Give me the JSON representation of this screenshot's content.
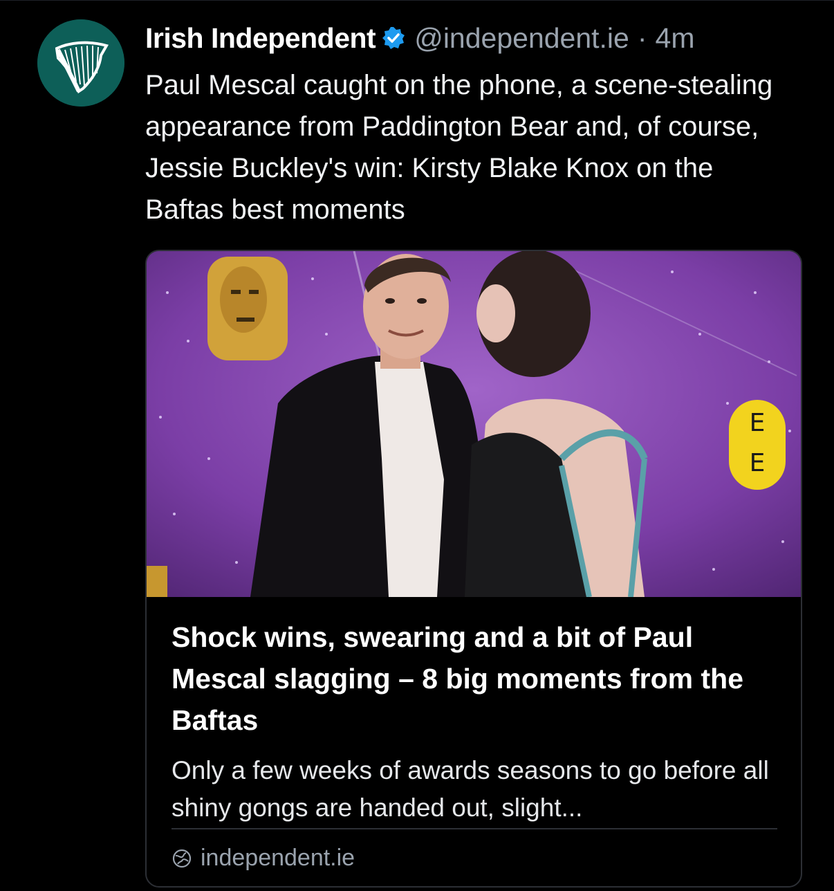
{
  "post": {
    "author_name": "Irish Independent",
    "handle": "@independent.ie",
    "separator": "·",
    "timestamp": "4m",
    "text": "Paul Mescal caught on the phone, a scene-stealing appearance from Paddington Bear and, of course, Jessie Buckley's win: Kirsty Blake Knox on the Baftas best moments"
  },
  "link_card": {
    "title": "Shock wins, swearing and a bit of Paul Mescal slagging – 8 big moments from the Baftas",
    "description": "Only a few weeks of awards seasons to go before all shiny gongs are handed out, slight...",
    "domain": "independent.ie",
    "image_letters": [
      "E",
      "E"
    ]
  },
  "icons": {
    "avatar": "harp-logo-icon",
    "verified": "verified-badge-icon",
    "source": "globe-icon"
  },
  "colors": {
    "background": "#000000",
    "avatar_bg": "#0d5f58",
    "verified": "#1d9bf0",
    "muted_text": "#9aa3ae",
    "card_border": "#2c2f35"
  }
}
